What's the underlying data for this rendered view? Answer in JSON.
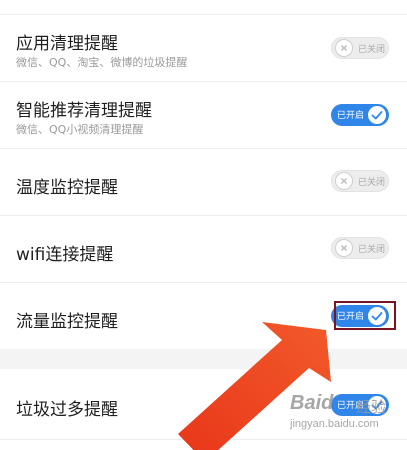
{
  "settings": [
    {
      "title": "应用清理提醒",
      "subtitle": "微信、QQ、淘宝、微博的垃圾提醒",
      "state": "off",
      "toggle_label": "已关闭"
    },
    {
      "title": "智能推荐清理提醒",
      "subtitle": "微信、QQ小视频清理提醒",
      "state": "on",
      "toggle_label": "已开启"
    },
    {
      "title": "温度监控提醒",
      "subtitle": "",
      "state": "off",
      "toggle_label": "已关闭"
    },
    {
      "title": "wifi连接提醒",
      "subtitle": "",
      "state": "off",
      "toggle_label": "已关闭"
    },
    {
      "title": "流量监控提醒",
      "subtitle": "",
      "state": "on",
      "toggle_label": "已开启"
    },
    {
      "title": "垃圾过多提醒",
      "subtitle": "",
      "state": "on",
      "toggle_label": "已开启"
    }
  ],
  "watermark": {
    "brand": "Baid",
    "suffix": "经验",
    "url": "jingyan.baidu.com"
  },
  "colors": {
    "toggle_on": "#2f86e8",
    "toggle_off": "#ededed",
    "annotation_box": "#7a1420",
    "arrow": "#f0441f"
  }
}
